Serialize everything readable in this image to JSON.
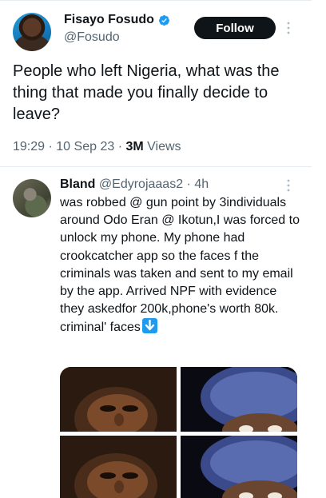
{
  "main_tweet": {
    "author_name": "Fisayo Fosudo",
    "author_handle": "@Fosudo",
    "follow_label": "Follow",
    "text": "People who left Nigeria, what was the thing that made you finally decide to leave?",
    "time": "19:29",
    "date": "10 Sep 23",
    "views_count": "3M",
    "views_label": "Views"
  },
  "reply": {
    "author_name": "Bland",
    "author_handle": "@Edyrojaaas2",
    "age": "4h",
    "text": "was robbed @ gun point by 3individuals around Odo Eran @ Ikotun,I was forced to unlock my phone. My phone had crookcatcher app so the faces f the criminals was taken and sent to my email by the app. Arrived NPF with evidence they askedfor 200k,phone's worth 80k. criminal' faces"
  },
  "colors": {
    "text": "#0f1419",
    "secondary": "#536471",
    "accent": "#1d9bf0",
    "divider": "#e6ecf0"
  },
  "icons": [
    "verified-badge-icon",
    "more-options-icon",
    "down-arrow-emoji-icon"
  ]
}
